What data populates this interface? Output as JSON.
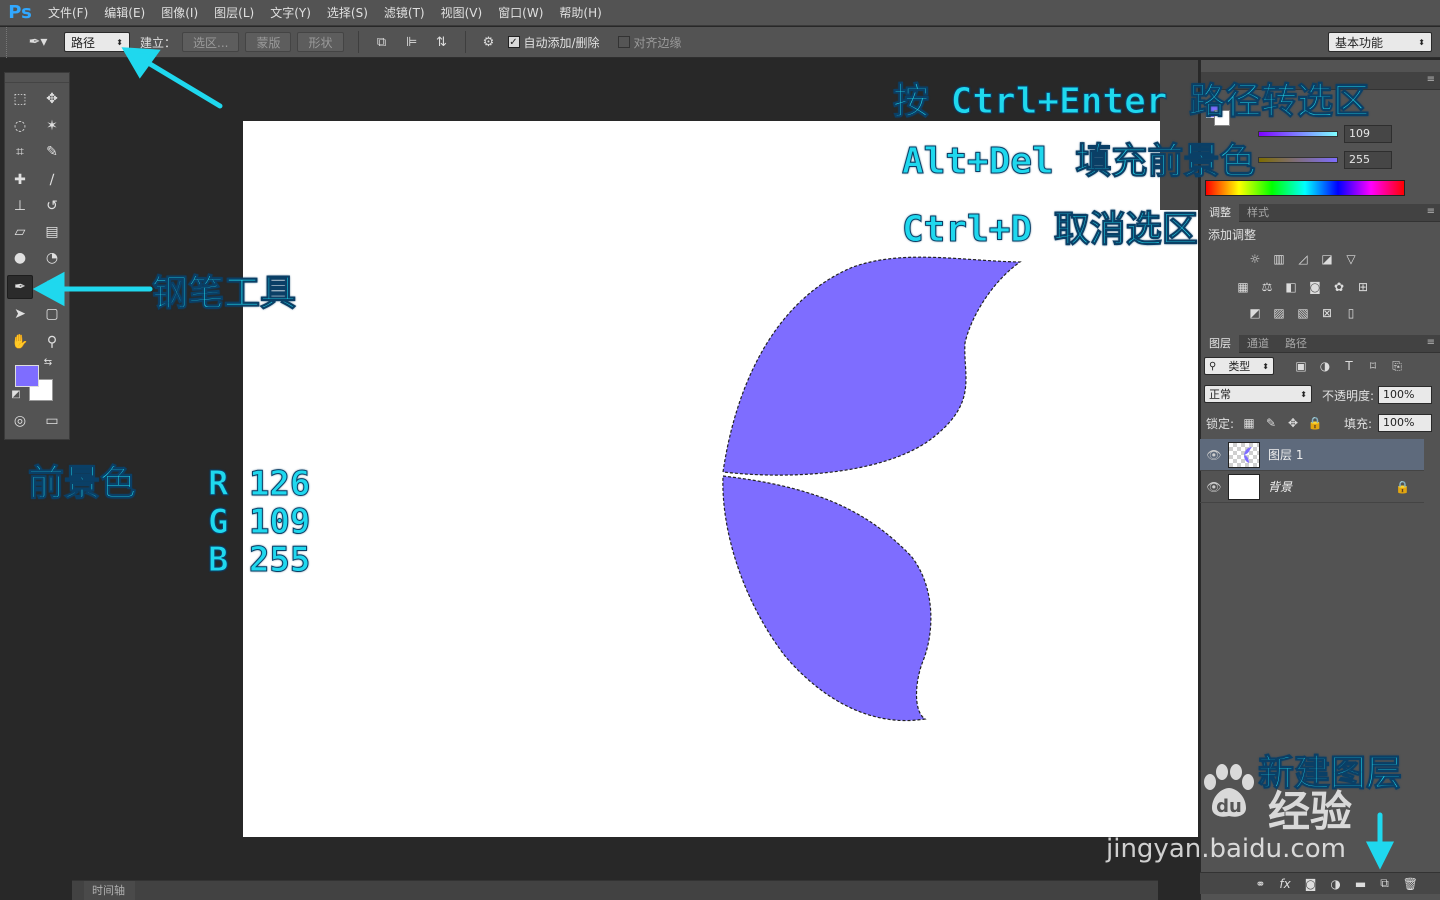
{
  "app": {
    "logo": "Ps"
  },
  "menu": [
    "文件(F)",
    "编辑(E)",
    "图像(I)",
    "图层(L)",
    "文字(Y)",
    "选择(S)",
    "滤镜(T)",
    "视图(V)",
    "窗口(W)",
    "帮助(H)"
  ],
  "options": {
    "mode_value": "路径",
    "make_label": "建立：",
    "selection_btn": "选区...",
    "mask_btn": "蒙版",
    "shape_btn": "形状",
    "auto_add_label": "自动添加/删除",
    "auto_add_checked": true,
    "align_edges_label": "对齐边缘",
    "align_edges_checked": false,
    "workspace": "基本功能"
  },
  "colors": {
    "foreground": "#7e6dff",
    "background": "#ffffff",
    "g_value": "109",
    "b_value": "255"
  },
  "adjustments": {
    "tabs": [
      "调整",
      "样式"
    ],
    "title": "添加调整"
  },
  "layers_panel": {
    "tabs": [
      "图层",
      "通道",
      "路径"
    ],
    "filter": "类型",
    "blend_mode": "正常",
    "opacity_label": "不透明度:",
    "opacity": "100%",
    "lock_label": "锁定:",
    "fill_label": "填充:",
    "fill": "100%",
    "layers": [
      {
        "name": "图层 1",
        "selected": true
      },
      {
        "name": "背景",
        "selected": false,
        "locked": true
      }
    ]
  },
  "timeline": {
    "tab": "时间轴"
  },
  "annotations": {
    "step1": "按 Ctrl+Enter 路径转选区",
    "step2": "Alt+Del 填充前景色",
    "step3": "Ctrl+D 取消选区",
    "pen_tool": "钢笔工具",
    "fg_color": "前景色",
    "rgb_r": "R 126",
    "rgb_g": "G 109",
    "rgb_b": "B 255",
    "new_layer": "新建图层"
  },
  "watermark": {
    "brand": "Bai",
    "brand2": "经验",
    "url": "jingyan.baidu.com"
  }
}
